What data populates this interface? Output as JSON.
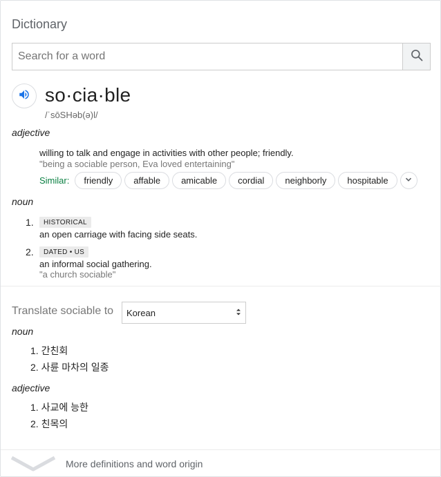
{
  "header": {
    "title": "Dictionary"
  },
  "search": {
    "placeholder": "Search for a word",
    "value": ""
  },
  "entry": {
    "word": "so·cia·ble",
    "phonetic": "/ˈsōSHəb(ə)l/"
  },
  "adjective": {
    "pos": "adjective",
    "definition": "willing to talk and engage in activities with other people; friendly.",
    "example": "\"being a sociable person, Eva loved entertaining\"",
    "similar_label": "Similar:",
    "similar": [
      "friendly",
      "affable",
      "amicable",
      "cordial",
      "neighborly",
      "hospitable"
    ]
  },
  "noun": {
    "pos": "noun",
    "senses": [
      {
        "num": "1.",
        "label": "HISTORICAL",
        "definition": "an open carriage with facing side seats.",
        "example": ""
      },
      {
        "num": "2.",
        "label": "DATED • US",
        "definition": "an informal social gathering.",
        "example": "\"a church sociable\""
      }
    ]
  },
  "translate": {
    "label": "Translate sociable to",
    "language": "Korean",
    "noun_pos": "noun",
    "noun_items": [
      "1. 간친회",
      "2. 사륜 마차의 일종"
    ],
    "adj_pos": "adjective",
    "adj_items": [
      "1. 사교에 능한",
      "2. 친목의"
    ]
  },
  "footer": {
    "more_label": "More definitions and word origin"
  },
  "colors": {
    "similar_label": "#0b8043",
    "speaker_icon": "#1a73e8",
    "tag_bg": "#ebebeb"
  }
}
